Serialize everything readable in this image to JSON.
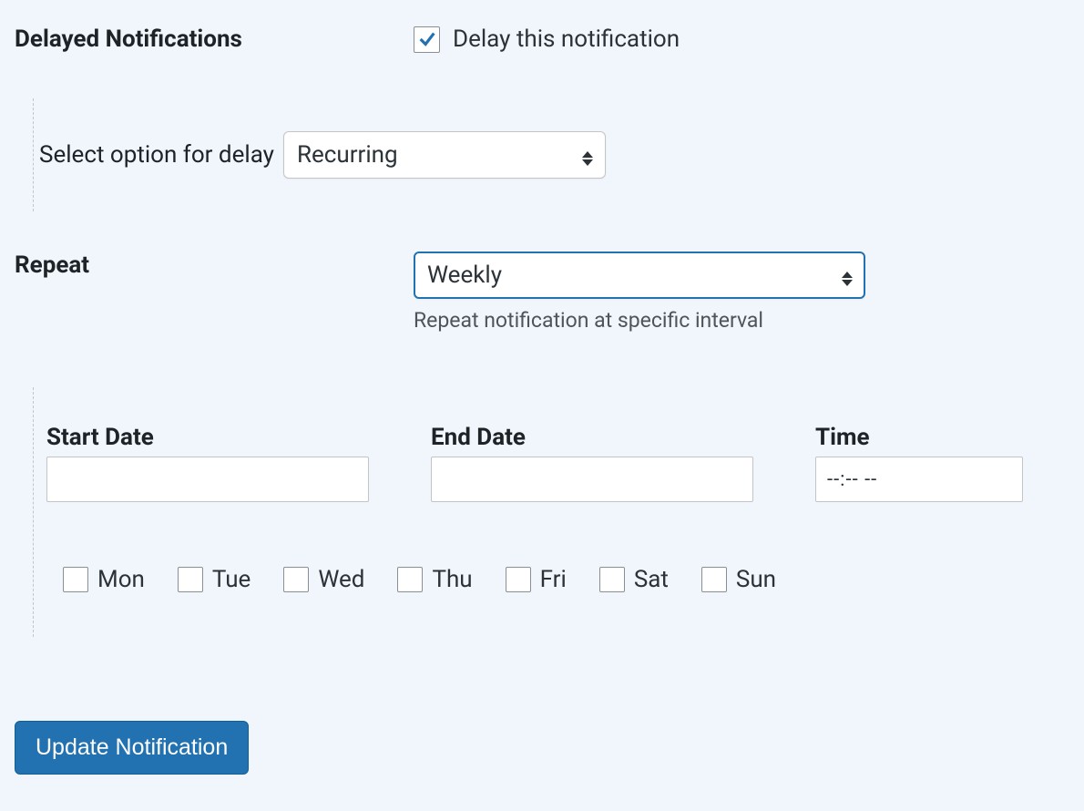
{
  "sections": {
    "delayed_title": "Delayed Notifications",
    "delay_checkbox_label": "Delay this notification",
    "delay_checked": true,
    "select_delay_label": "Select option for delay",
    "select_delay_value": "Recurring",
    "repeat_title": "Repeat",
    "repeat_value": "Weekly",
    "repeat_helper": "Repeat notification at specific interval",
    "start_date_label": "Start Date",
    "start_date_value": "",
    "end_date_label": "End Date",
    "end_date_value": "",
    "time_label": "Time",
    "time_value": "--:-- --"
  },
  "days": [
    {
      "label": "Mon",
      "checked": false
    },
    {
      "label": "Tue",
      "checked": false
    },
    {
      "label": "Wed",
      "checked": false
    },
    {
      "label": "Thu",
      "checked": false
    },
    {
      "label": "Fri",
      "checked": false
    },
    {
      "label": "Sat",
      "checked": false
    },
    {
      "label": "Sun",
      "checked": false
    }
  ],
  "submit_label": "Update Notification"
}
